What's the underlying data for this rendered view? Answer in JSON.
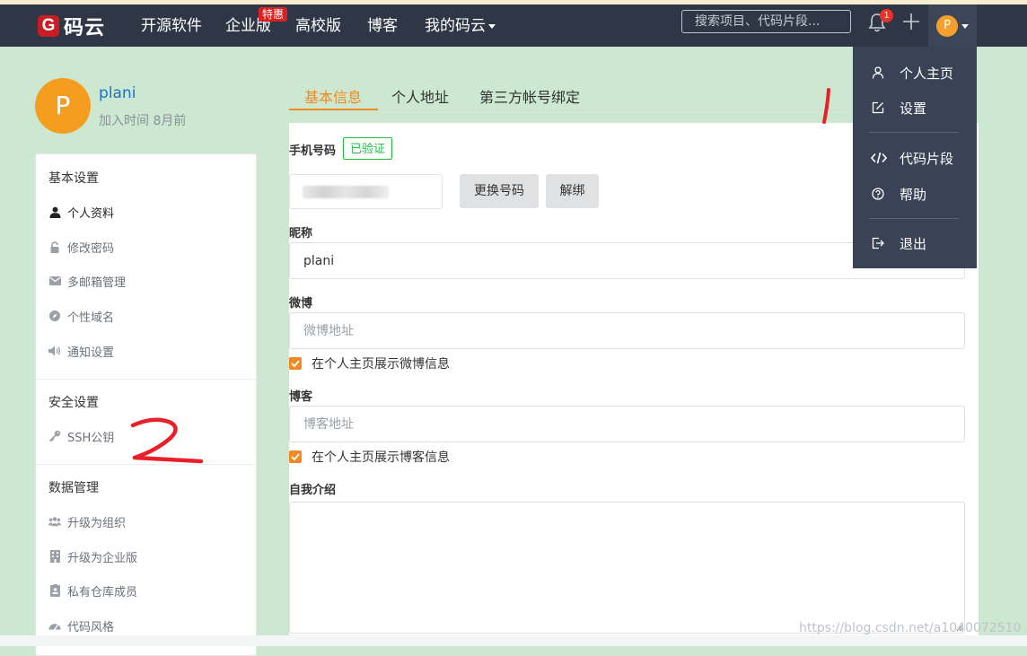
{
  "nav": {
    "logo_mark": "G",
    "logo_text": "码云",
    "links": [
      "开源软件",
      "企业版",
      "高校版",
      "博客",
      "我的码云"
    ],
    "hot_badge": "特惠",
    "search_placeholder": "搜索项目、代码片段...",
    "notification_count": "1",
    "user_initial": "P"
  },
  "profile": {
    "initial": "P",
    "name": "plani",
    "joined": "加入时间 8月前"
  },
  "sidebar": {
    "sections": [
      {
        "title": "基本设置",
        "items": [
          {
            "label": "个人资料",
            "icon": "user-icon"
          },
          {
            "label": "修改密码",
            "icon": "lock-icon"
          },
          {
            "label": "多邮箱管理",
            "icon": "envelope-icon"
          },
          {
            "label": "个性域名",
            "icon": "compass-icon"
          },
          {
            "label": "通知设置",
            "icon": "volume-icon"
          }
        ]
      },
      {
        "title": "安全设置",
        "items": [
          {
            "label": "SSH公钥",
            "icon": "key-icon"
          }
        ]
      },
      {
        "title": "数据管理",
        "items": [
          {
            "label": "升级为组织",
            "icon": "users-icon"
          },
          {
            "label": "升级为企业版",
            "icon": "building-icon"
          },
          {
            "label": "私有仓库成员",
            "icon": "badge-icon"
          },
          {
            "label": "代码风格",
            "icon": "dashboard-icon"
          }
        ]
      }
    ]
  },
  "tabs": [
    "基本信息",
    "个人地址",
    "第三方帐号绑定"
  ],
  "form": {
    "phone_label": "手机号码",
    "verified": "已验证",
    "change_phone": "更换号码",
    "unbind": "解绑",
    "nickname_label": "昵称",
    "nickname_value": "plani",
    "weibo_label": "微博",
    "weibo_placeholder": "微博地址",
    "weibo_show": "在个人主页展示微博信息",
    "blog_label": "博客",
    "blog_placeholder": "博客地址",
    "blog_show": "在个人主页展示博客信息",
    "bio_label": "自我介绍"
  },
  "dropdown": {
    "items": [
      {
        "label": "个人主页",
        "icon": "person-icon"
      },
      {
        "label": "设置",
        "icon": "edit-icon"
      },
      {
        "label": "代码片段",
        "icon": "code-icon"
      },
      {
        "label": "帮助",
        "icon": "help-icon"
      },
      {
        "label": "退出",
        "icon": "logout-icon"
      }
    ]
  },
  "watermark": "https://blog.csdn.net/a1040072510",
  "colors": {
    "accent": "#f08a24",
    "nav_bg": "#2f3645",
    "page_bg": "#cce8d0",
    "verified_green": "#21ba45",
    "annotation_red": "#e8202a"
  }
}
